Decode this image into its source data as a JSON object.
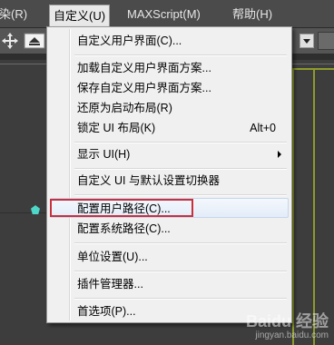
{
  "menubar": {
    "items": [
      {
        "label": "渲染(R)"
      },
      {
        "label": "自定义(U)"
      },
      {
        "label": "MAXScript(M)"
      },
      {
        "label": "帮助(H)"
      }
    ]
  },
  "menu": {
    "items": [
      {
        "label": "自定义用户界面(C)..."
      },
      {
        "label": "加载自定义用户界面方案..."
      },
      {
        "label": "保存自定义用户界面方案..."
      },
      {
        "label": "还原为启动布局(R)"
      },
      {
        "label": "锁定 UI 布局(K)",
        "shortcut": "Alt+0"
      },
      {
        "label": "显示 UI(H)"
      },
      {
        "label": "自定义 UI 与默认设置切换器"
      },
      {
        "label": "配置用户路径(C)..."
      },
      {
        "label": "配置系统路径(C)..."
      },
      {
        "label": "单位设置(U)..."
      },
      {
        "label": "插件管理器..."
      },
      {
        "label": "首选项(P)..."
      }
    ]
  },
  "watermark": {
    "brand": "Baidu 经验",
    "url": "jingyan.baidu.com"
  },
  "colors": {
    "highlight": "#c8303b",
    "accent_dot": "#4ed6c8"
  }
}
